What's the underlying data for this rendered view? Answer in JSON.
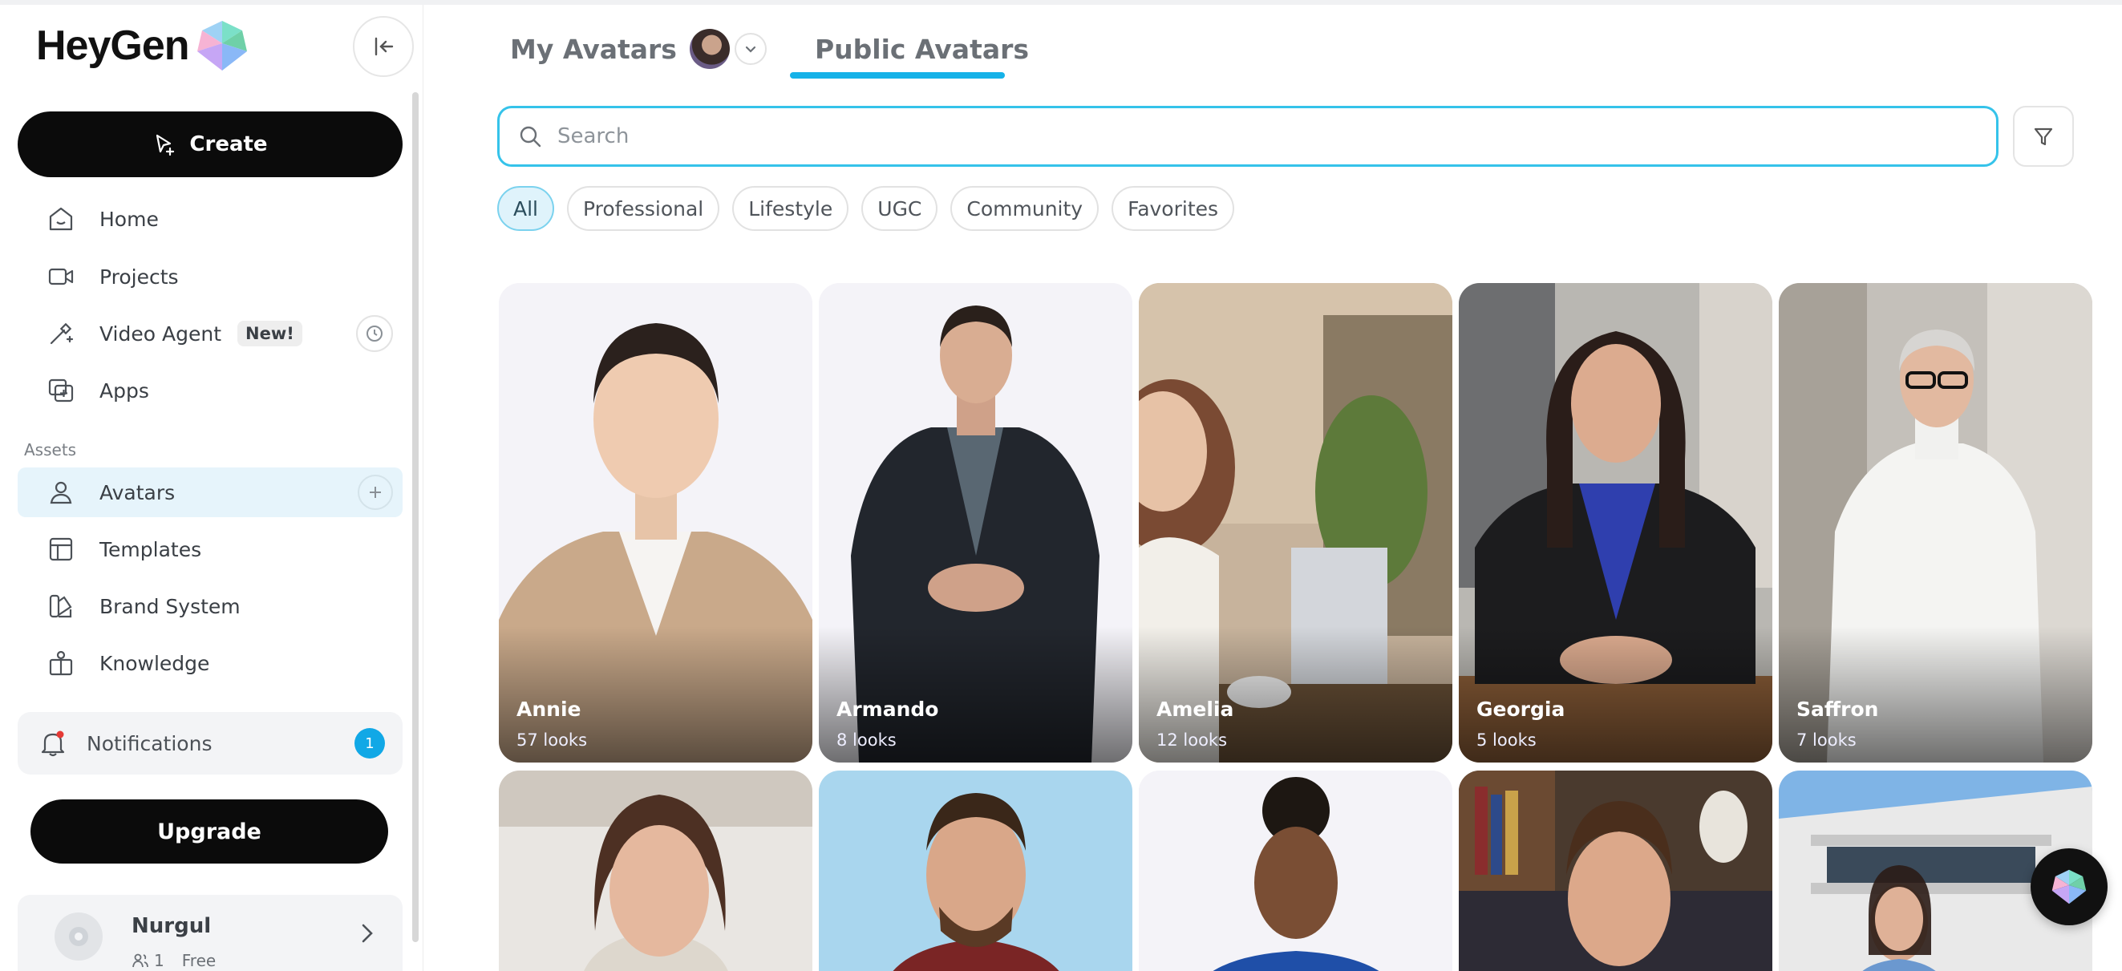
{
  "app": {
    "logo_text": "HeyGen"
  },
  "sidebar": {
    "create_label": "Create",
    "nav": [
      {
        "label": "Home",
        "icon": "home-icon"
      },
      {
        "label": "Projects",
        "icon": "video-camera-icon"
      },
      {
        "label": "Video Agent",
        "icon": "magic-wand-icon",
        "badge": "New!"
      },
      {
        "label": "Apps",
        "icon": "apps-icon"
      }
    ],
    "assets_label": "Assets",
    "assets": [
      {
        "label": "Avatars",
        "icon": "user-icon",
        "active": true
      },
      {
        "label": "Templates",
        "icon": "template-icon"
      },
      {
        "label": "Brand System",
        "icon": "brand-icon"
      },
      {
        "label": "Knowledge",
        "icon": "knowledge-icon"
      }
    ],
    "notifications_label": "Notifications",
    "notifications_count": "1",
    "upgrade_label": "Upgrade",
    "user": {
      "name": "Nurgul",
      "members": "1",
      "plan": "Free"
    }
  },
  "tabs": {
    "my_avatars": "My Avatars",
    "public_avatars": "Public Avatars",
    "active": "Public Avatars"
  },
  "search": {
    "placeholder": "Search",
    "value": ""
  },
  "filters": [
    "All",
    "Professional",
    "Lifestyle",
    "UGC",
    "Community",
    "Favorites"
  ],
  "active_filter": "All",
  "avatars": [
    {
      "name": "Annie",
      "looks": "57 looks"
    },
    {
      "name": "Armando",
      "looks": "8 looks"
    },
    {
      "name": "Amelia",
      "looks": "12 looks"
    },
    {
      "name": "Georgia",
      "looks": "5 looks"
    },
    {
      "name": "Saffron",
      "looks": "7 looks"
    }
  ],
  "colors": {
    "accent": "#16b2e8",
    "active_nav_bg": "#e6f4fb",
    "button_dark": "#0b0b0b",
    "notification_badge": "#11a8e6"
  }
}
